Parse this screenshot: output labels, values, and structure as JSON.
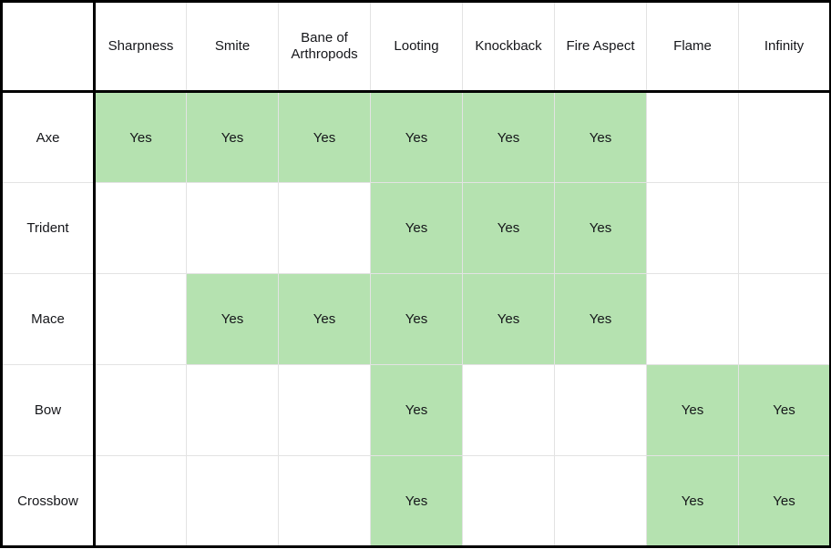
{
  "table": {
    "corner_label": "",
    "columns": [
      "Sharpness",
      "Smite",
      "Bane of Arthropods",
      "Looting",
      "Knockback",
      "Fire Aspect",
      "Flame",
      "Infinity"
    ],
    "rows": [
      "Axe",
      "Trident",
      "Mace",
      "Bow",
      "Crossbow"
    ],
    "yes_label": "Yes",
    "empty_label": "",
    "colors": {
      "yes_fill": "#b5e2b0",
      "empty_fill": "#ffffff",
      "grid_line": "#e3e3e3",
      "frame": "#000000",
      "text": "#15161a"
    },
    "cells": [
      [
        "Yes",
        "Yes",
        "Yes",
        "Yes",
        "Yes",
        "Yes",
        "",
        ""
      ],
      [
        "",
        "",
        "",
        "Yes",
        "Yes",
        "Yes",
        "",
        ""
      ],
      [
        "",
        "Yes",
        "Yes",
        "Yes",
        "Yes",
        "Yes",
        "",
        ""
      ],
      [
        "",
        "",
        "",
        "Yes",
        "",
        "",
        "Yes",
        "Yes"
      ],
      [
        "",
        "",
        "",
        "Yes",
        "",
        "",
        "Yes",
        "Yes"
      ]
    ]
  }
}
